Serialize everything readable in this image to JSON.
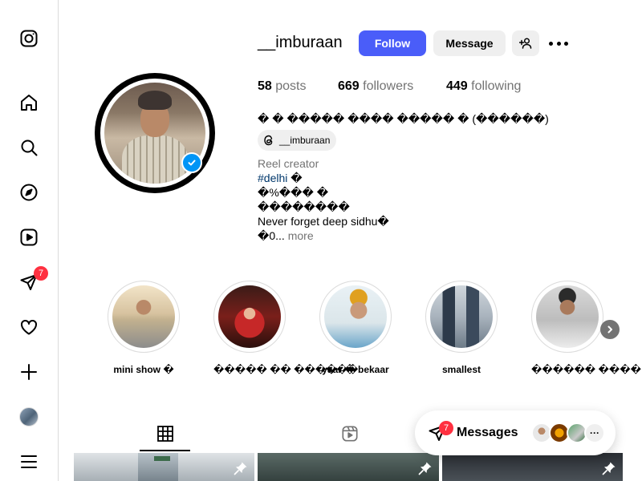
{
  "colors": {
    "accent": "#4a5df9",
    "badge": "#ff3040",
    "secondary_text": "#737373",
    "link": "#00376b",
    "verified": "#0095f6"
  },
  "sidebar": {
    "items": [
      {
        "name": "instagram-logo-icon"
      },
      {
        "name": "home-icon"
      },
      {
        "name": "search-icon"
      },
      {
        "name": "explore-icon"
      },
      {
        "name": "reels-icon"
      },
      {
        "name": "messages-icon",
        "badge": "7"
      },
      {
        "name": "notifications-heart-icon"
      },
      {
        "name": "create-plus-icon"
      },
      {
        "name": "profile-avatar"
      },
      {
        "name": "more-menu-icon"
      }
    ]
  },
  "profile": {
    "username": "__imburaan",
    "follow_label": "Follow",
    "message_label": "Message",
    "stats": {
      "posts_count": "58",
      "posts_label": "posts",
      "followers_count": "669",
      "followers_label": "followers",
      "following_count": "449",
      "following_label": "following"
    },
    "bio": {
      "name_line": "� � ����� ���� ����� � (������)",
      "threads_handle": "__imburaan",
      "category": "Reel creator",
      "hashtag": "#delhi",
      "hashtag_suffix": " �",
      "line3": "�%��� �",
      "line4": "��������",
      "line5": "Never forget deep sidhu�",
      "line6": "�0...",
      "more": "more"
    }
  },
  "highlights": [
    {
      "label": "mini show �"
    },
    {
      "label": "����� �� ������"
    },
    {
      "label": "yaar � bekaar"
    },
    {
      "label": "smallest"
    },
    {
      "label": "������ ����"
    }
  ],
  "messages_widget": {
    "label": "Messages",
    "badge": "7",
    "more": "···"
  }
}
